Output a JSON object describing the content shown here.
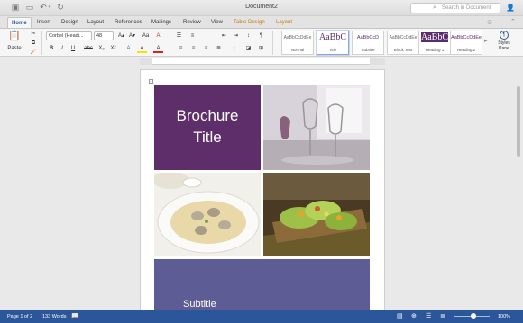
{
  "window": {
    "title": "Document2",
    "search_placeholder": "Search in Document"
  },
  "tabs": [
    {
      "label": "Home",
      "active": true
    },
    {
      "label": "Insert"
    },
    {
      "label": "Design"
    },
    {
      "label": "Layout"
    },
    {
      "label": "References"
    },
    {
      "label": "Mailings"
    },
    {
      "label": "Review"
    },
    {
      "label": "View"
    },
    {
      "label": "Table Design",
      "contextual": true
    },
    {
      "label": "Layout",
      "contextual": true
    }
  ],
  "ribbon": {
    "paste_label": "Paste",
    "font_name": "Corbel (Headi...",
    "font_size": "48",
    "bold": "B",
    "italic": "I",
    "underline": "U",
    "strike": "abc",
    "subscript": "X₂",
    "superscript": "X²",
    "grow_font": "A▴",
    "shrink_font": "A▾",
    "case": "Aa",
    "clear": "A",
    "highlight": "A",
    "font_color": "A",
    "pilcrow": "¶",
    "styles": [
      {
        "preview": "AaBbCcDdEe",
        "name": "Normal"
      },
      {
        "preview": "AaBbC",
        "name": "Title"
      },
      {
        "preview": "AaBbCcD",
        "name": "Subtitle"
      },
      {
        "preview": "AaBbCcDdEe",
        "name": "Block Text"
      },
      {
        "preview": "AaBbC",
        "name": "Heading 1"
      },
      {
        "preview": "AaBbCcDdEe",
        "name": "Heading 2"
      }
    ],
    "styles_pane_line1": "Styles",
    "styles_pane_line2": "Pane"
  },
  "document": {
    "title_line1": "Brochure",
    "title_line2": "Title",
    "subtitle": "Subtitle"
  },
  "status": {
    "page": "Page 1 of 2",
    "words": "133 Words",
    "zoom": "100%"
  },
  "colors": {
    "brochure_purple": "#5e2e6b",
    "subtitle_band": "#5e5c94",
    "statusbar_blue": "#2b579a"
  }
}
